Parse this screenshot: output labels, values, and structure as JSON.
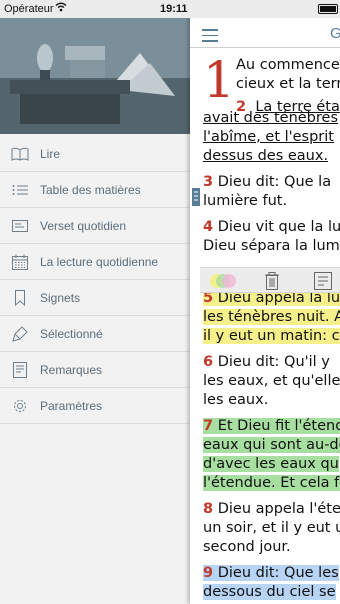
{
  "status": {
    "carrier": "Opérateur",
    "time": "19:11"
  },
  "sidebar": {
    "items": [
      {
        "label": "Lire",
        "icon": "book-open-icon"
      },
      {
        "label": "Table des matières",
        "icon": "list-icon"
      },
      {
        "label": "Verset quotidien",
        "icon": "card-icon"
      },
      {
        "label": "La lecture quotidienne",
        "icon": "calendar-icon"
      },
      {
        "label": "Signets",
        "icon": "bookmark-icon"
      },
      {
        "label": "Sélectionné",
        "icon": "highlighter-icon"
      },
      {
        "label": "Remarques",
        "icon": "notes-icon"
      },
      {
        "label": "Paramètres",
        "icon": "gear-icon"
      }
    ]
  },
  "header": {
    "title_fragment": "G"
  },
  "bible": {
    "chapter": "1",
    "v1": [
      "Au commence",
      "cieux et la terr"
    ],
    "v2": {
      "num": "2",
      "lines": [
        "La terre éta",
        "avait des ténèbres",
        "l'abîme, et l'esprit",
        "dessus des eaux."
      ]
    },
    "v3": {
      "num": "3",
      "lines": [
        "Dieu dit: Que la",
        "lumière fut."
      ]
    },
    "v4": {
      "num": "4",
      "lines": [
        "Dieu vit que la lu",
        "Dieu sépara la lum"
      ]
    },
    "v5": {
      "num": "5",
      "lines": [
        "Dieu appela la lu",
        "les ténèbres nuit. A",
        "il y eut un matin: c"
      ]
    },
    "v6": {
      "num": "6",
      "lines": [
        "Dieu dit: Qu'il y",
        "les eaux, et qu'elle",
        "les eaux."
      ]
    },
    "v7": {
      "num": "7",
      "lines": [
        "Et Dieu fit l'étend",
        "eaux qui sont au-de",
        "d'avec les eaux qu",
        "l'étendue. Et cela fu"
      ]
    },
    "v8": {
      "num": "8",
      "lines": [
        "Dieu appela l'éte",
        "un soir, et il y eut u",
        "second jour."
      ]
    },
    "v9": {
      "num": "9",
      "lines": [
        "Dieu dit: Que les",
        "dessous du ciel se"
      ]
    }
  },
  "colors": {
    "accent": "#5a7d96",
    "verse_number": "#c0392b",
    "highlight_yellow": "#f6f08a",
    "highlight_green": "#a7dfa1",
    "highlight_blue": "#b7d4f4"
  }
}
